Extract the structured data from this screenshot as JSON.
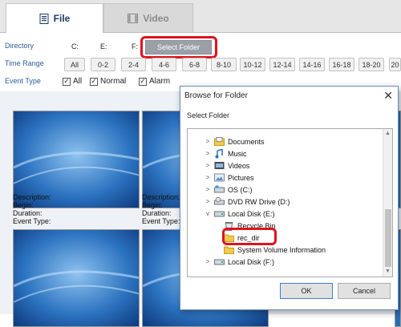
{
  "tabs": [
    {
      "label": "File",
      "icon": "document-icon"
    },
    {
      "label": "Video",
      "icon": "film-icon"
    }
  ],
  "filters": {
    "directory_label": "Directory",
    "drives": [
      "C:",
      "E:",
      "F:"
    ],
    "select_folder_label": "Select Folder",
    "time_range_label": "Time Range",
    "time_buttons": [
      "All",
      "0-2",
      "2-4",
      "4-6",
      "6-8",
      "8-10",
      "10-12",
      "12-14",
      "14-16",
      "16-18",
      "18-20",
      "20"
    ],
    "event_type_label": "Event Type",
    "event_types": [
      {
        "label": "All",
        "checked": true
      },
      {
        "label": "Normal",
        "checked": true
      },
      {
        "label": "Alarm",
        "checked": true
      }
    ]
  },
  "file_info": {
    "description": "Description:",
    "begin": "Begin:",
    "duration": "Duration:",
    "event_type": "Event Type:"
  },
  "dialog": {
    "title": "Browse for Folder",
    "close": "✕",
    "prompt": "Select Folder",
    "tree": [
      {
        "label": "Documents",
        "icon": "documents-folder-icon",
        "expander": ">"
      },
      {
        "label": "Music",
        "icon": "music-icon",
        "expander": ">"
      },
      {
        "label": "Videos",
        "icon": "videos-folder-icon",
        "expander": ">"
      },
      {
        "label": "Pictures",
        "icon": "pictures-folder-icon",
        "expander": ">"
      },
      {
        "label": "OS (C:)",
        "icon": "os-drive-icon",
        "expander": ">"
      },
      {
        "label": "DVD RW Drive (D:)",
        "icon": "dvd-drive-icon",
        "expander": ">"
      },
      {
        "label": "Local Disk (E:)",
        "icon": "disk-drive-icon",
        "expander": "v"
      },
      {
        "label": "Recycle Bin",
        "icon": "recycle-bin-icon",
        "expander": ""
      },
      {
        "label": "rec_dir",
        "icon": "folder-icon",
        "expander": ""
      },
      {
        "label": "System Volume Information",
        "icon": "folder-icon",
        "expander": ""
      },
      {
        "label": "Local Disk (F:)",
        "icon": "disk-drive-icon",
        "expander": ">"
      }
    ],
    "ok_label": "OK",
    "cancel_label": "Cancel"
  },
  "colors": {
    "highlight": "#e0121b",
    "label_blue": "#2a5b9a",
    "folder_yellow": "#f2c94c"
  }
}
